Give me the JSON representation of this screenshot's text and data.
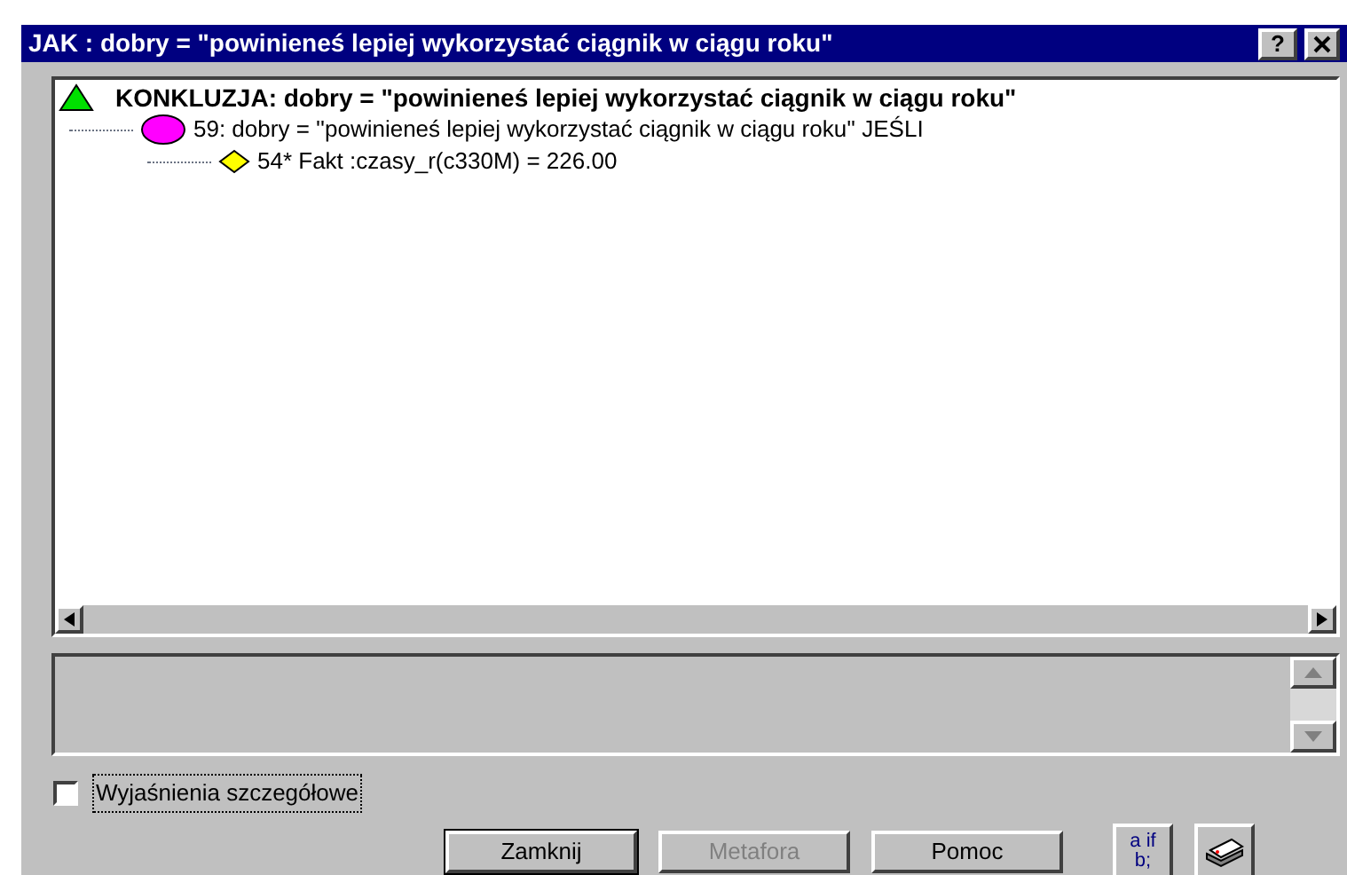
{
  "window": {
    "title": "JAK : dobry = \"powinieneś lepiej wykorzystać ciągnik w ciągu roku\"",
    "help_button": "?"
  },
  "tree": [
    {
      "kind": "conclusion",
      "label": "KONKLUZJA: dobry = \"powinieneś lepiej wykorzystać ciągnik w ciągu roku\"",
      "children": [
        {
          "kind": "rule",
          "label": "59: dobry = ''powinieneś lepiej wykorzystać ciągnik w ciągu roku'' JEŚLI",
          "children": [
            {
              "kind": "fact",
              "label": "54* Fakt :czasy_r(c330M) = 226.00"
            }
          ]
        }
      ]
    }
  ],
  "detail_checkbox": {
    "label": "Wyjaśnienia szczegółowe",
    "checked": false
  },
  "buttons": [
    {
      "label": "Zamknij",
      "disabled": false
    },
    {
      "label": "Metafora",
      "disabled": true
    },
    {
      "label": "Pomoc",
      "disabled": false
    }
  ],
  "syntax_button": {
    "line1": "a if",
    "line2": "b;"
  }
}
